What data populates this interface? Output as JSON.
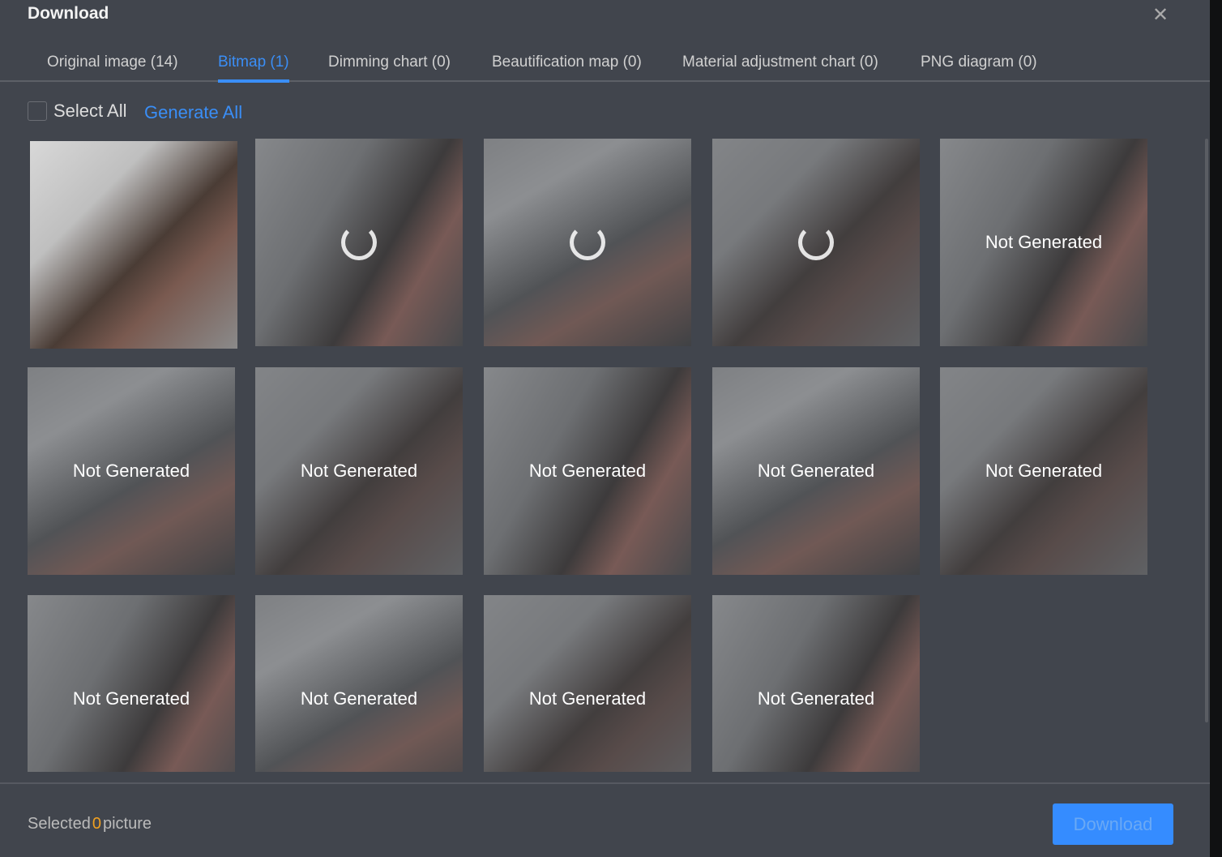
{
  "dialog": {
    "title": "Download",
    "close_icon": "close-icon"
  },
  "tabs": [
    {
      "label": "Original image (14)"
    },
    {
      "label": "Bitmap (1)",
      "active": true
    },
    {
      "label": "Dimming chart (0)"
    },
    {
      "label": "Beautification map (0)"
    },
    {
      "label": "Material adjustment chart (0)"
    },
    {
      "label": "PNG diagram (0)"
    }
  ],
  "toolbar": {
    "select_all": "Select All",
    "generate_all": "Generate All"
  },
  "images": [
    {
      "status": "generated"
    },
    {
      "status": "loading"
    },
    {
      "status": "loading"
    },
    {
      "status": "loading"
    },
    {
      "status": "not",
      "label": "Not Generated"
    },
    {
      "status": "not",
      "label": "Not Generated"
    },
    {
      "status": "not",
      "label": "Not Generated"
    },
    {
      "status": "not",
      "label": "Not Generated"
    },
    {
      "status": "not",
      "label": "Not Generated"
    },
    {
      "status": "not",
      "label": "Not Generated"
    },
    {
      "status": "not",
      "label": "Not Generated"
    },
    {
      "status": "not",
      "label": "Not Generated"
    },
    {
      "status": "not",
      "label": "Not Generated"
    },
    {
      "status": "not",
      "label": "Not Generated"
    }
  ],
  "footer": {
    "prefix": "Selected",
    "count": "0",
    "suffix": "picture",
    "download": "Download"
  },
  "colors": {
    "accent": "#3a8ef6",
    "background": "#41454d",
    "count": "#f0a020"
  }
}
